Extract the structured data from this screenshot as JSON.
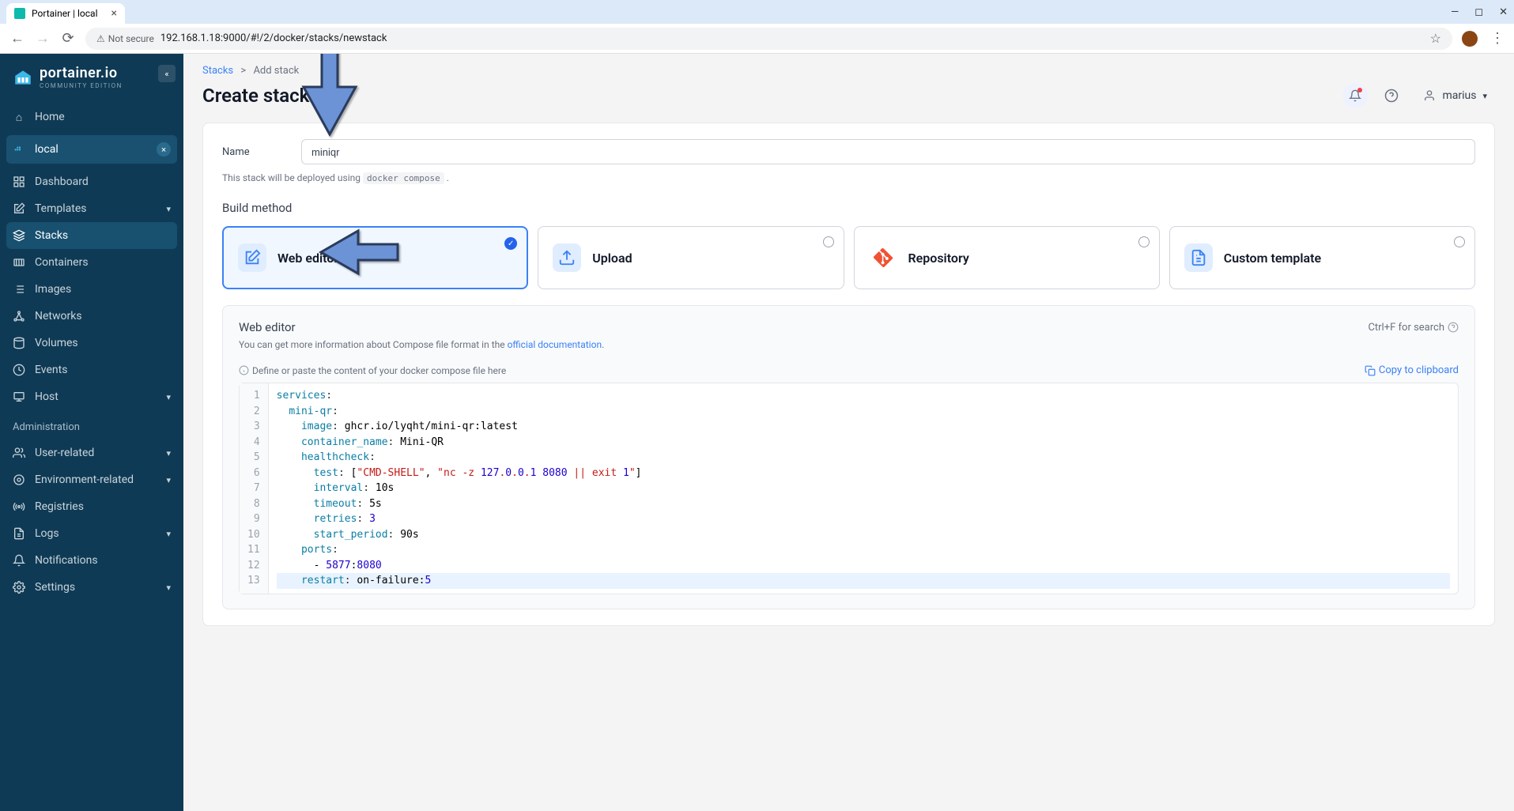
{
  "browser": {
    "tab_title": "Portainer | local",
    "not_secure": "Not secure",
    "url": "192.168.1.18:9000/#!/2/docker/stacks/newstack"
  },
  "sidebar": {
    "brand": "portainer.io",
    "brand_sub": "COMMUNITY EDITION",
    "home": "Home",
    "env_label": "local",
    "items": [
      {
        "icon": "dashboard",
        "label": "Dashboard"
      },
      {
        "icon": "templates",
        "label": "Templates",
        "chevron": true
      },
      {
        "icon": "stacks",
        "label": "Stacks",
        "active": true
      },
      {
        "icon": "containers",
        "label": "Containers"
      },
      {
        "icon": "images",
        "label": "Images"
      },
      {
        "icon": "networks",
        "label": "Networks"
      },
      {
        "icon": "volumes",
        "label": "Volumes"
      },
      {
        "icon": "events",
        "label": "Events"
      },
      {
        "icon": "host",
        "label": "Host",
        "chevron": true
      }
    ],
    "admin_label": "Administration",
    "admin_items": [
      {
        "icon": "users",
        "label": "User-related",
        "chevron": true
      },
      {
        "icon": "env",
        "label": "Environment-related",
        "chevron": true
      },
      {
        "icon": "registries",
        "label": "Registries"
      },
      {
        "icon": "logs",
        "label": "Logs",
        "chevron": true
      },
      {
        "icon": "notifications",
        "label": "Notifications"
      },
      {
        "icon": "settings",
        "label": "Settings",
        "chevron": true
      }
    ]
  },
  "breadcrumb": {
    "root": "Stacks",
    "sep": ">",
    "leaf": "Add stack"
  },
  "page": {
    "title": "Create stack",
    "user": "marius"
  },
  "form": {
    "name_label": "Name",
    "name_value": "miniqr",
    "deploy_hint_pre": "This stack will be deployed using ",
    "deploy_hint_code": "docker compose",
    "deploy_hint_post": " ."
  },
  "build": {
    "title": "Build method",
    "methods": [
      {
        "key": "web-editor",
        "label": "Web editor",
        "selected": true
      },
      {
        "key": "upload",
        "label": "Upload"
      },
      {
        "key": "repository",
        "label": "Repository"
      },
      {
        "key": "custom-template",
        "label": "Custom template"
      }
    ]
  },
  "editor": {
    "title": "Web editor",
    "shortcut": "Ctrl+F for search",
    "hint_pre": "You can get more information about Compose file format in the ",
    "hint_link": "official documentation",
    "hint_post": ".",
    "placeholder": "Define or paste the content of your docker compose file here",
    "copy_label": "Copy to clipboard",
    "code_lines": [
      "services:",
      "  mini-qr:",
      "    image: ghcr.io/lyqht/mini-qr:latest",
      "    container_name: Mini-QR",
      "    healthcheck:",
      "      test: [\"CMD-SHELL\", \"nc -z 127.0.0.1 8080 || exit 1\"]",
      "      interval: 10s",
      "      timeout: 5s",
      "      retries: 3",
      "      start_period: 90s",
      "    ports:",
      "      - 5877:8080",
      "    restart: on-failure:5"
    ]
  }
}
